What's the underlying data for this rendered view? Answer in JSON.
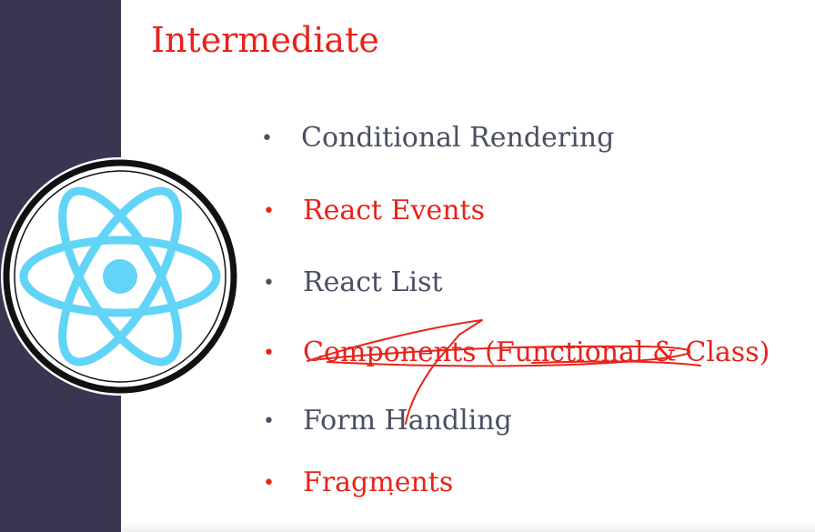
{
  "slide": {
    "title": "Intermediate",
    "title_color": "#e8231a",
    "items": [
      {
        "text": "Conditional Rendering",
        "color": "#4a4f63"
      },
      {
        "text": "React Events",
        "color": "#e8231a"
      },
      {
        "text": "React List",
        "color": "#4a4f63"
      },
      {
        "text": "Components (Functional & Class)",
        "color": "#e8231a"
      },
      {
        "text": "Form Handling",
        "color": "#4a4f63"
      },
      {
        "text": "Fragments",
        "color": "#e8231a"
      }
    ]
  },
  "sidebar": {
    "color": "#393650",
    "logo_icon": "react-atom-icon",
    "logo_color": "#61d4f7"
  },
  "annotation": {
    "icon": "strikethrough-scribble",
    "color": "#e8231a"
  }
}
